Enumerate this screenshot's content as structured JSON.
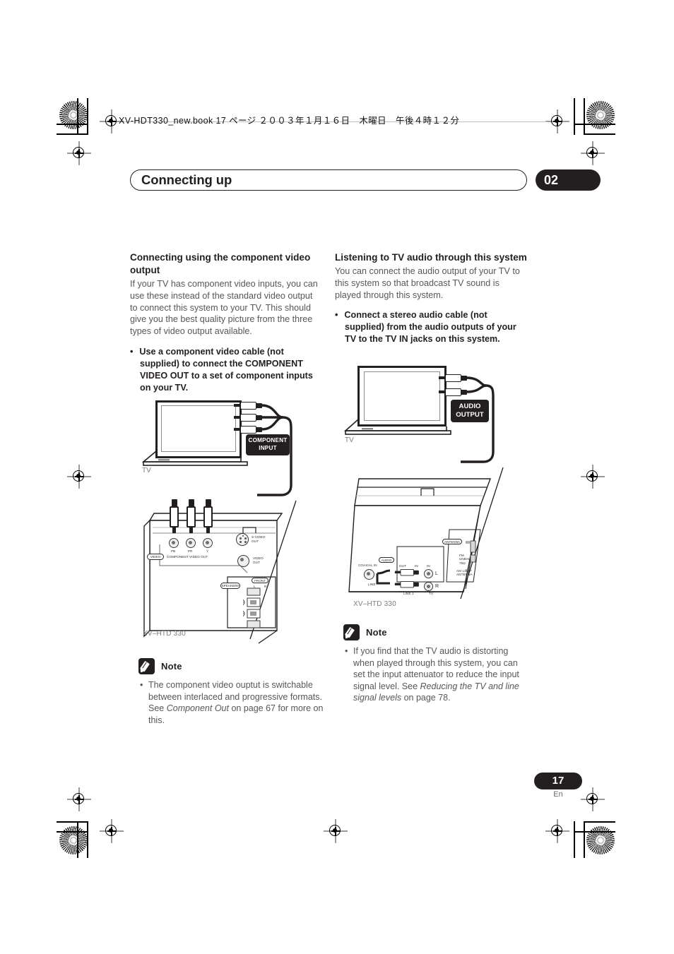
{
  "print_header": {
    "text": "XV-HDT330_new.book  17 ページ  ２００３年１月１６日　木曜日　午後４時１２分"
  },
  "running_head": {
    "title": "Connecting up",
    "chapter": "02"
  },
  "left_column": {
    "heading": "Connecting using the component video output",
    "paragraph": "If your TV has component video inputs, you can use these instead of the standard video output to connect this system to your TV. This should give you the best quality picture from the three types of video output available.",
    "bullet": "Use a component video cable (not supplied) to connect the COMPONENT VIDEO OUT to a set of component inputs on your TV.",
    "bullet_marker": "•",
    "note": {
      "label": "Note",
      "items": [
        {
          "part1": "The component video ouptut is switchable between interlaced and progressive formats. See ",
          "italic": "Component Out",
          "part2": " on page 67 for more on this."
        }
      ]
    },
    "figure": {
      "tv_label": "TV",
      "input_badge_line1": "COMPONENT",
      "input_badge_line2": "INPUT",
      "unit_name": "XV–HTD 330",
      "panel_labels": {
        "video_badge": "VIDEO",
        "component_video_out": "COMPONENT VIDEO OUT",
        "jack_pb": "PB",
        "jack_pr": "PR",
        "jack_y": "Y",
        "svideo_out_1": "S-VIDEO",
        "svideo_out_2": "OUT",
        "video_out_1": "VIDEO",
        "video_out_2": "OUT",
        "speakers_badge": "SPEAKERS",
        "front_badge": "FRONT",
        "front_left": "L",
        "front_right": "R",
        "polarity_plus": "+",
        "polarity_minus": "−"
      }
    }
  },
  "right_column": {
    "heading": "Listening to TV audio through this system",
    "paragraph": "You can connect the audio output of your TV to this system so that broadcast TV sound is played through this system.",
    "bullet": "Connect a stereo audio cable (not supplied) from the audio outputs of your TV to the TV IN jacks on this system.",
    "bullet_marker": "•",
    "note": {
      "label": "Note",
      "items": [
        {
          "part1": "If you find that the TV audio is distorting when played through this system, you can set the input attenuator to reduce the input signal level. See ",
          "italic": "Reducing the TV and line signal levels",
          "part2": " on page 78."
        }
      ]
    },
    "figure": {
      "tv_label": "TV",
      "output_badge_line1": "AUDIO",
      "output_badge_line2": "OUTPUT",
      "unit_name": "XV–HTD 330",
      "panel_labels": {
        "audio_badge": "AUDIO",
        "coaxial_in": "COAXIAL IN",
        "line": "LINE",
        "out": "OUT",
        "in_label": "IN",
        "in_right": "IN",
        "line1": "LINE 1",
        "tv": "TV",
        "channel_l": "L",
        "channel_r": "R",
        "antenna_badge": "ANTENNA",
        "fm_unbal": "FM UNBAL 75Ω",
        "am_loop": "AM LOOP ANTENNA"
      }
    }
  },
  "footer": {
    "page_number": "17",
    "language": "En"
  },
  "colors": {
    "ink": "#231f20",
    "body_text": "#575757",
    "muted": "#7d7d7d",
    "badge_bg": "#231f20"
  }
}
